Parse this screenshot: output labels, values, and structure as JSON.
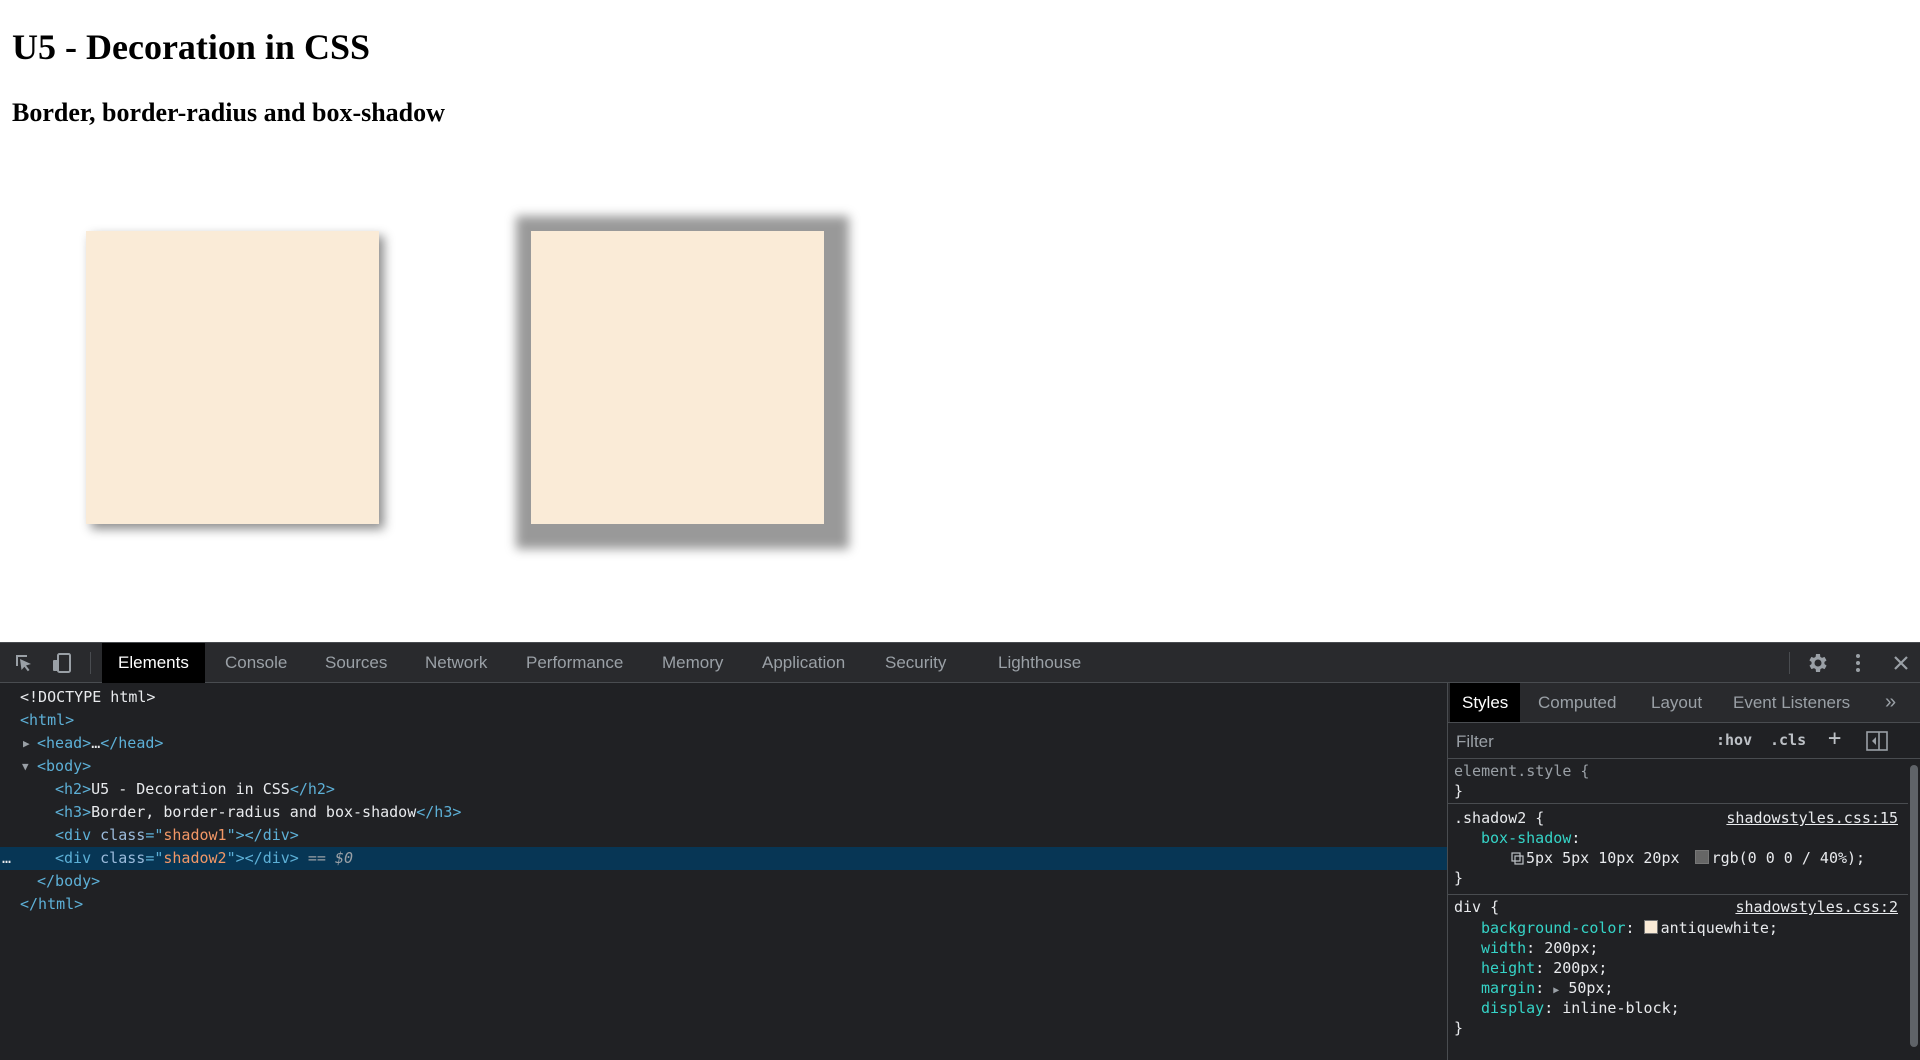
{
  "page": {
    "h2": "U5 - Decoration in CSS",
    "h3": "Border, border-radius and box-shadow"
  },
  "devtools": {
    "tabs": [
      {
        "label": "Elements",
        "active": true
      },
      {
        "label": "Console"
      },
      {
        "label": "Sources"
      },
      {
        "label": "Network"
      },
      {
        "label": "Performance"
      },
      {
        "label": "Memory"
      },
      {
        "label": "Application"
      },
      {
        "label": "Security"
      },
      {
        "label": "Lighthouse"
      }
    ],
    "toolbar_icons": [
      "inspect-element-icon",
      "device-toolbar-icon",
      "gear-icon",
      "more-vert-icon",
      "close-icon"
    ],
    "dom": {
      "doctype": "<!DOCTYPE html>",
      "html_open": "<html>",
      "head_open": "<head>",
      "ellipsis": "…",
      "head_close": "</head>",
      "body_open": "<body>",
      "h2_open": "<h2>",
      "h2_text": "U5 - Decoration in CSS",
      "h2_close": "</h2>",
      "h3_open": "<h3>",
      "h3_text": "Border, border-radius and box-shadow",
      "h3_close": "</h3>",
      "div_open": "<div",
      "class_attr": "class",
      "eq_quote": "=\"",
      "quote": "\"",
      "div_end": "></div>",
      "class1": "shadow1",
      "class2": "shadow2",
      "selected_marker": "== $0",
      "dots": "…",
      "body_close": "</body>",
      "html_close": "</html>"
    },
    "styles": {
      "tabs": [
        "Styles",
        "Computed",
        "Layout",
        "Event Listeners"
      ],
      "more_tabs": "»",
      "filter_placeholder": "Filter",
      "hov": ":hov",
      "cls": ".cls",
      "add": "+",
      "element_style": "element.style {",
      "close_brace": "}",
      "rule1": {
        "selector": ".shadow2 {",
        "source": "shadowstyles.css:15",
        "prop": "box-shadow",
        "value_a": "5px 5px 10px 20px",
        "value_b": "rgb(0 0 0 / 40%);",
        "swatch_color": "#666666"
      },
      "rule2": {
        "selector": "div {",
        "source": "shadowstyles.css:2",
        "props": [
          {
            "name": "background-color",
            "value": "antiquewhite;",
            "swatch": "#faebd7"
          },
          {
            "name": "width",
            "value": "200px;"
          },
          {
            "name": "height",
            "value": "200px;"
          },
          {
            "name": "margin",
            "value": "50px;",
            "expandable": true
          },
          {
            "name": "display",
            "value": "inline-block;"
          }
        ]
      }
    }
  }
}
